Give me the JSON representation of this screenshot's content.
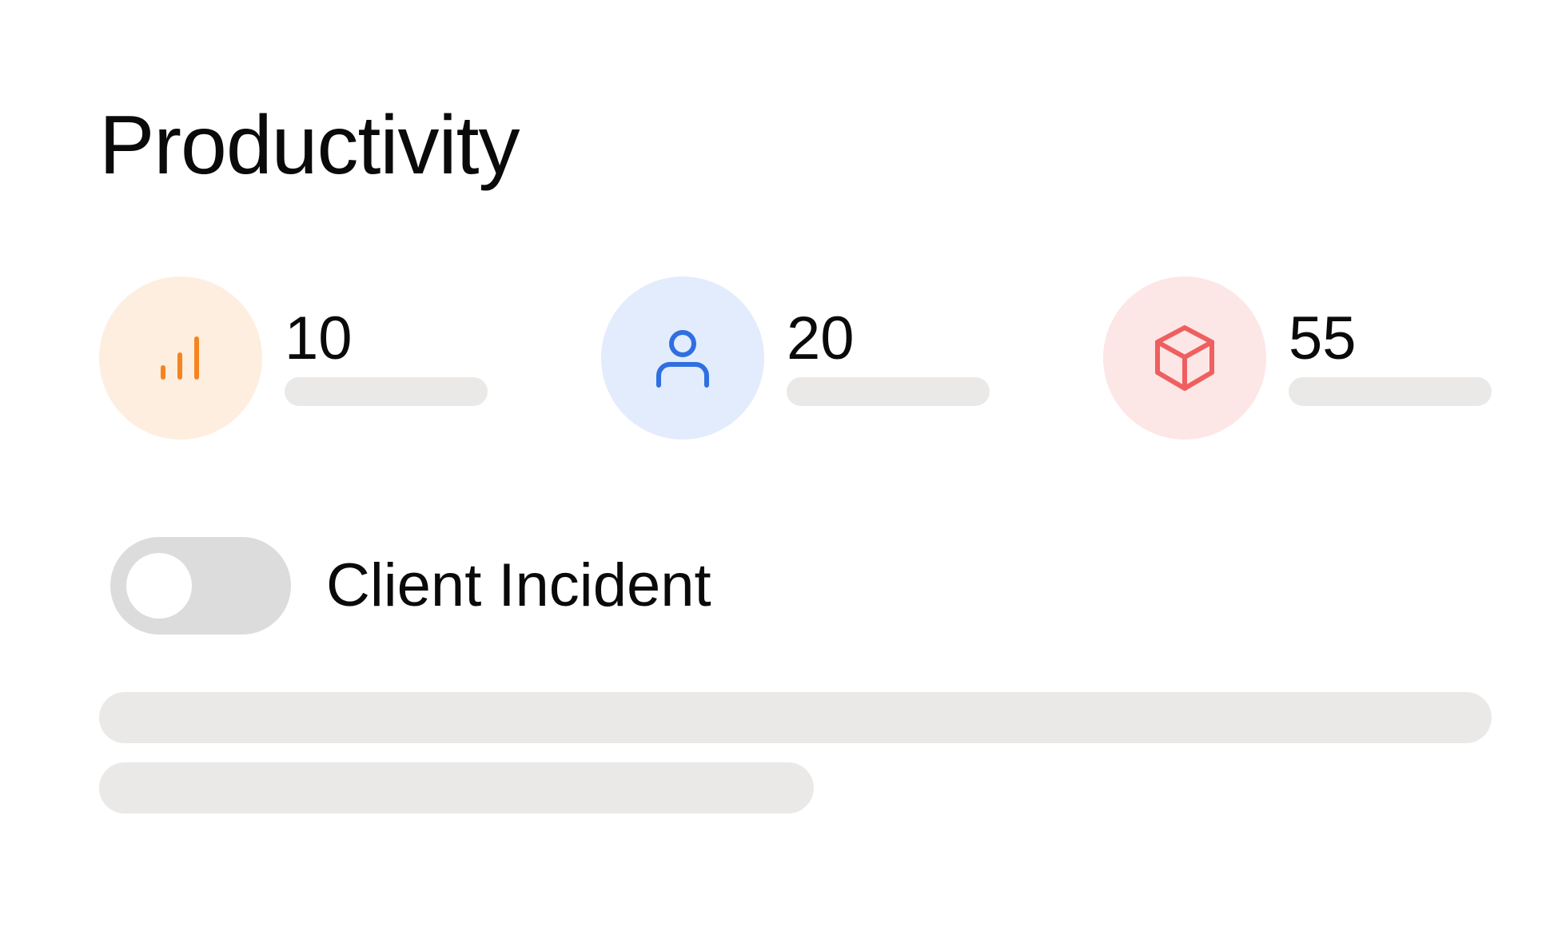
{
  "title": "Productivity",
  "stats": [
    {
      "value": "10",
      "icon": "bar-chart-icon",
      "icon_color": "#f5841f",
      "bg_color": "#feeedf"
    },
    {
      "value": "20",
      "icon": "user-icon",
      "icon_color": "#2f6fe0",
      "bg_color": "#e2ecfc"
    },
    {
      "value": "55",
      "icon": "cube-icon",
      "icon_color": "#ef5f5f",
      "bg_color": "#fde6e6"
    }
  ],
  "toggle": {
    "label": "Client Incident",
    "checked": false
  }
}
